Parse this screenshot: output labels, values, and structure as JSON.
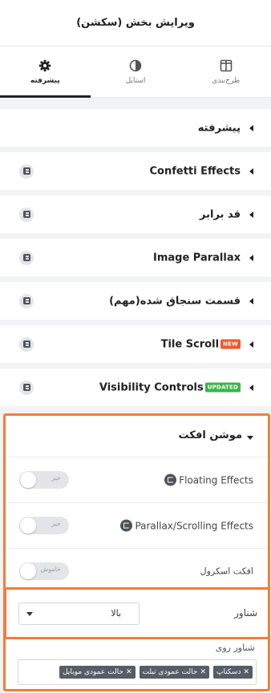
{
  "header": {
    "title": "ویرایش بخش (سکشن)"
  },
  "tabs": [
    {
      "label": "طرح‌بندی",
      "icon": "layout-icon",
      "active": false
    },
    {
      "label": "استایل",
      "icon": "contrast-icon",
      "active": false
    },
    {
      "label": "پیشرفته",
      "icon": "gear-icon",
      "active": true
    }
  ],
  "sections": [
    {
      "label": "پیشرفته",
      "pro": false,
      "tag": ""
    },
    {
      "label": "Confetti Effects",
      "pro": true,
      "tag": ""
    },
    {
      "label": "قد برابر",
      "pro": true,
      "tag": ""
    },
    {
      "label": "Image Parallax",
      "pro": true,
      "tag": ""
    },
    {
      "label": "قسمت سنجاق شده(مهم)",
      "pro": true,
      "tag": ""
    },
    {
      "label": "Tile Scroll",
      "pro": true,
      "tag": "NEW"
    },
    {
      "label": "Visibility Controls",
      "pro": true,
      "tag": "UPDATED"
    }
  ],
  "motion": {
    "title": "موشن افکت",
    "floating_effects": {
      "label": "Floating Effects",
      "toggle_text": "خیر"
    },
    "parallax": {
      "label": "Parallax/Scrolling Effects",
      "toggle_text": "خیر"
    },
    "scroll_effect": {
      "label": "افکت اسکرول",
      "toggle_text": "خاموش"
    },
    "floating": {
      "label": "شناور",
      "value": "بالا"
    },
    "floating_on": {
      "label": "شناور روی",
      "chips": [
        "دسکتاپ",
        "حالت عمودی تبلت",
        "حالت عمودی موبایل"
      ]
    }
  },
  "colors": {
    "accent": "#f47c3c",
    "new_badge": "#ed5a2c",
    "updated_badge": "#39b54a"
  }
}
